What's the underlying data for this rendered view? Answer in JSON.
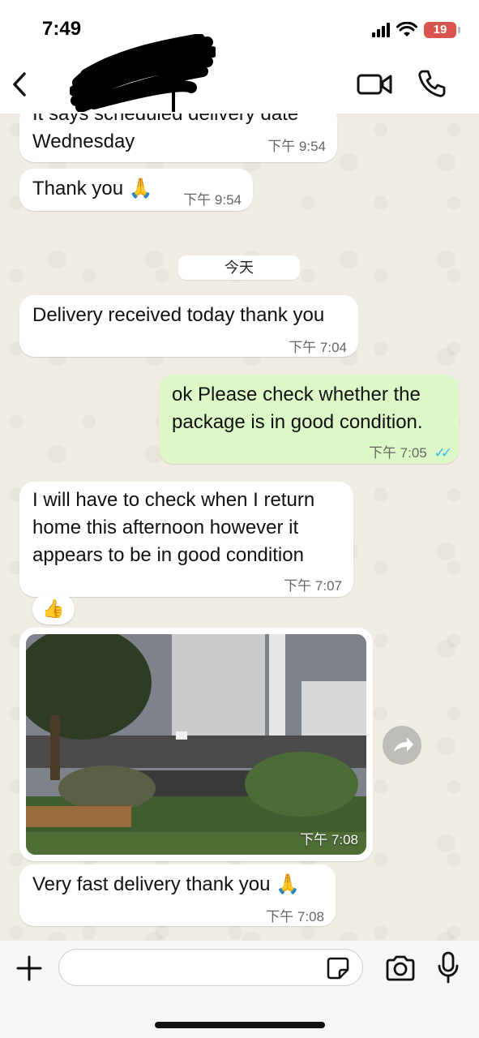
{
  "status_bar": {
    "time": "7:49",
    "battery": "19",
    "battery_color": "#d9534f"
  },
  "header": {
    "contact_name": "",
    "back_icon": "chevron-left-icon",
    "video_icon": "video-camera-icon",
    "call_icon": "phone-icon"
  },
  "date_chip": "今天",
  "messages": [
    {
      "direction": "in",
      "text_lines": [
        "It says scheduled delivery date",
        "Wednesday"
      ],
      "time": "下午 9:54"
    },
    {
      "direction": "in",
      "text": "Thank you 🙏",
      "time": "下午 9:54"
    },
    {
      "direction": "in",
      "text": "Delivery received today thank you",
      "time": "下午 7:04"
    },
    {
      "direction": "out",
      "text_lines": [
        "ok Please check whether the",
        "package is in good condition."
      ],
      "time": "下午 7:05",
      "read_ticks": "✓✓",
      "read_color": "#34b7f1"
    },
    {
      "direction": "in",
      "text_lines": [
        "I will have to check when I return",
        "home this afternoon however it",
        "appears to be in good condition"
      ],
      "time": "下午 7:07",
      "reaction": "👍"
    },
    {
      "direction": "in",
      "type": "image",
      "time": "下午 7:08"
    },
    {
      "direction": "in",
      "text": "Very fast delivery thank you 🙏",
      "time": "下午 7:08"
    }
  ],
  "colors": {
    "outgoing_bubble": "#dcf8c6",
    "incoming_bubble": "#ffffff",
    "wallpaper": "#efeae2"
  },
  "input_bar": {
    "plus_icon": "plus-icon",
    "placeholder": "",
    "sticker_icon": "sticker-icon",
    "camera_icon": "camera-icon",
    "mic_icon": "microphone-icon"
  }
}
